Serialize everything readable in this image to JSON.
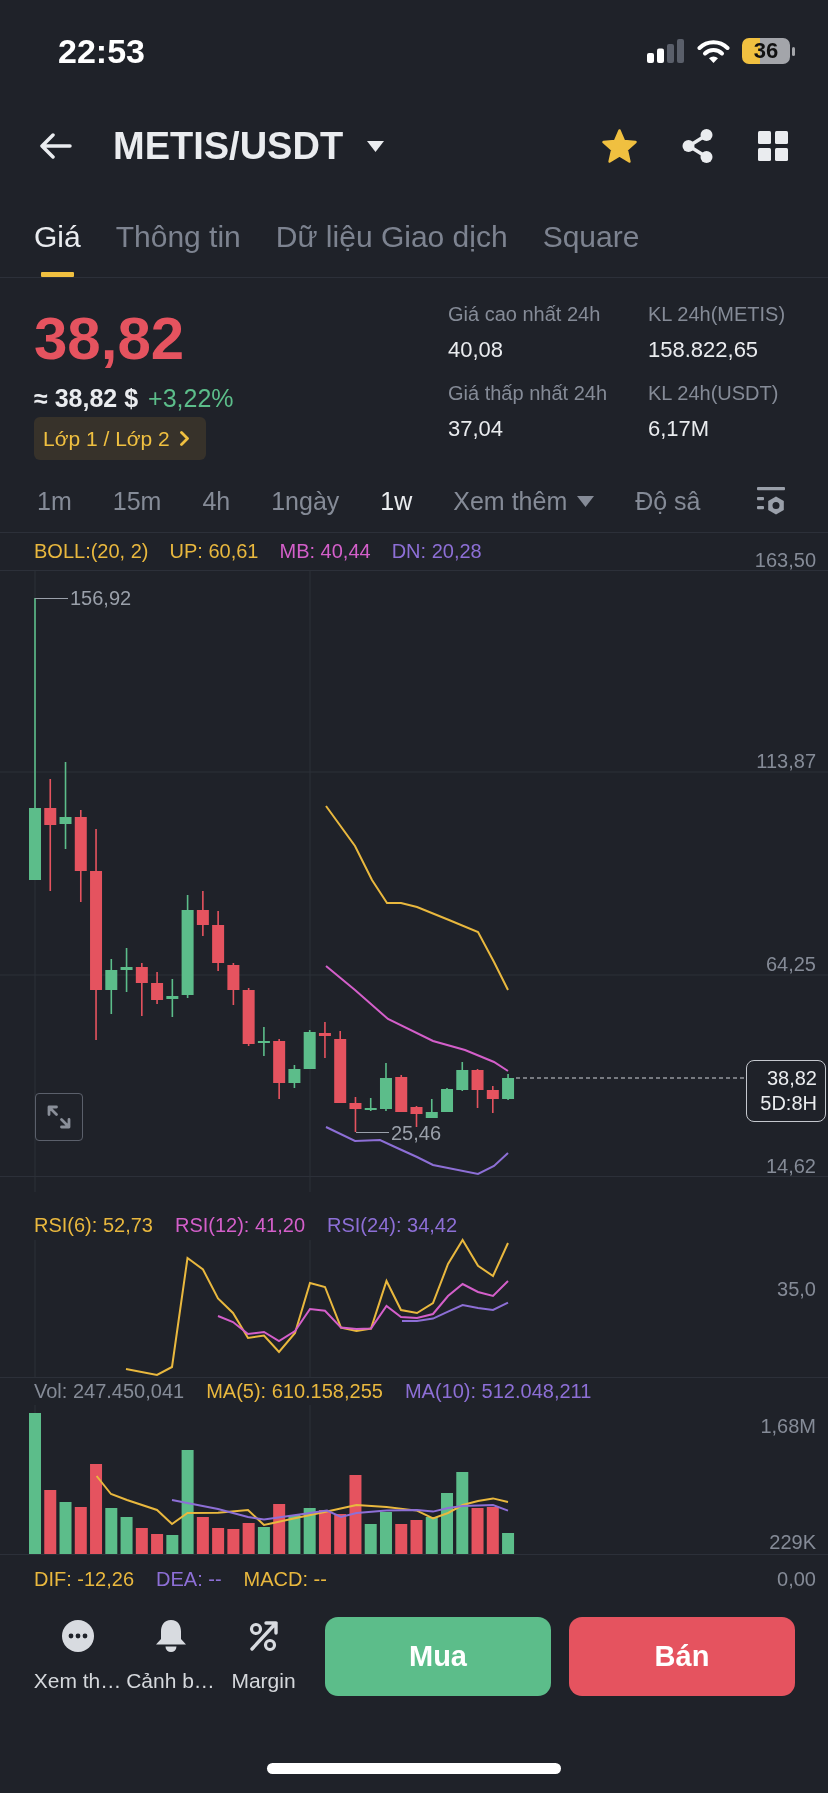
{
  "status_bar": {
    "time": "22:53",
    "battery": "36"
  },
  "header": {
    "title": "METIS/USDT",
    "favorite": true
  },
  "tabs": [
    {
      "label": "Giá",
      "selected": true
    },
    {
      "label": "Thông tin",
      "selected": false
    },
    {
      "label": "Dữ liệu Giao dịch",
      "selected": false
    },
    {
      "label": "Square",
      "selected": false
    }
  ],
  "ticker": {
    "price": "38,82",
    "price_up": false,
    "fiat_price": "≈ 38,82 $",
    "change": "+3,22%",
    "change_up": true,
    "tag": "Lớp 1 / Lớp 2"
  },
  "stats": [
    {
      "label": "Giá cao nhất 24h",
      "value": "40,08"
    },
    {
      "label": "KL 24h(METIS)",
      "value": "158.822,65"
    },
    {
      "label": "Giá thấp nhất 24h",
      "value": "37,04"
    },
    {
      "label": "KL 24h(USDT)",
      "value": "6,17M"
    }
  ],
  "interval_bar": {
    "intervals": [
      {
        "label": "1m",
        "selected": false
      },
      {
        "label": "15m",
        "selected": false
      },
      {
        "label": "4h",
        "selected": false
      },
      {
        "label": "1ngày",
        "selected": false
      },
      {
        "label": "1w",
        "selected": true
      }
    ],
    "more": "Xem thêm",
    "depth": "Độ sâ"
  },
  "price_chart": {
    "legend": [
      {
        "text": "BOLL:(20, 2)",
        "color": "#e9b83e"
      },
      {
        "text": "UP: 60,61",
        "color": "#e9b83e"
      },
      {
        "text": "MB: 40,44",
        "color": "#d45fca"
      },
      {
        "text": "DN: 20,28",
        "color": "#8d6fd6"
      }
    ],
    "axis_labels": [
      "163,50",
      "113,87",
      "64,25",
      "14,62"
    ],
    "high_label": "156,92",
    "low_label": "25,46",
    "last_price": "38,82",
    "countdown": "5D:8H"
  },
  "rsi_chart": {
    "legend": [
      {
        "text": "RSI(6): 52,73",
        "color": "#e9b83e"
      },
      {
        "text": "RSI(12): 41,20",
        "color": "#d45fca"
      },
      {
        "text": "RSI(24): 34,42",
        "color": "#8d6fd6"
      }
    ],
    "axis_label": "35,0"
  },
  "volume_chart": {
    "legend": [
      {
        "text": "Vol: 247.450,041",
        "color": "#858b97"
      },
      {
        "text": "MA(5): 610.158,255",
        "color": "#e9b83e"
      },
      {
        "text": "MA(10): 512.048,211",
        "color": "#8d6fd6"
      }
    ],
    "axis_labels": [
      "1,68M",
      "229K"
    ]
  },
  "macd": {
    "legend": [
      {
        "text": "DIF: -12,26",
        "color": "#e9b83e"
      },
      {
        "text": "DEA: --",
        "color": "#8d6fd6"
      },
      {
        "text": "MACD: --",
        "color": "#e9b83e"
      }
    ],
    "axis_label": "0,00"
  },
  "actions": [
    {
      "label": "Xem th…",
      "kind": "more"
    },
    {
      "label": "Cảnh b…",
      "kind": "alert"
    },
    {
      "label": "Margin",
      "kind": "margin"
    }
  ],
  "trade_buttons": [
    {
      "label": "Mua",
      "kind": "buy"
    },
    {
      "label": "Bán",
      "kind": "sell"
    }
  ]
}
